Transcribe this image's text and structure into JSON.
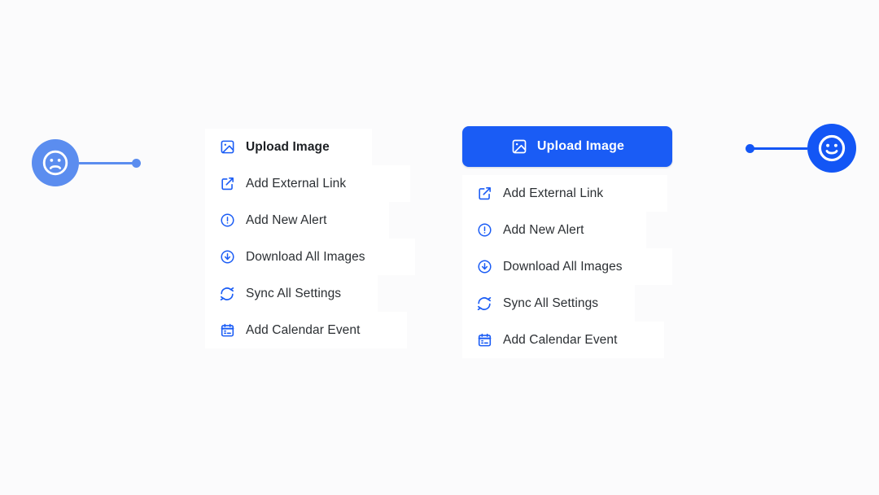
{
  "page": {
    "background_color": "#fbfbfc",
    "accent_color": "#1a5cf5",
    "muted_accent_color": "#5b8def"
  },
  "markers": {
    "before": {
      "name": "sad-face-marker",
      "face_icon": "sad-face-icon",
      "color": "#5b8def"
    },
    "after": {
      "name": "happy-face-marker",
      "face_icon": "happy-face-icon",
      "color": "#1356f5"
    }
  },
  "panel_before": {
    "items": [
      {
        "label": "Upload Image",
        "icon": "image-icon",
        "emphasis": "bold"
      },
      {
        "label": "Add External Link",
        "icon": "external-link-icon",
        "emphasis": "normal"
      },
      {
        "label": "Add New Alert",
        "icon": "alert-circle-icon",
        "emphasis": "normal"
      },
      {
        "label": "Download All Images",
        "icon": "download-circle-icon",
        "emphasis": "normal"
      },
      {
        "label": "Sync All Settings",
        "icon": "sync-icon",
        "emphasis": "normal"
      },
      {
        "label": "Add Calendar Event",
        "icon": "calendar-icon",
        "emphasis": "normal"
      }
    ]
  },
  "panel_after": {
    "primary_button": {
      "label": "Upload Image",
      "icon": "image-icon",
      "background_color": "#1a5cf5",
      "text_color": "#ffffff"
    },
    "items": [
      {
        "label": "Add External Link",
        "icon": "external-link-icon",
        "emphasis": "normal"
      },
      {
        "label": "Add New Alert",
        "icon": "alert-circle-icon",
        "emphasis": "normal"
      },
      {
        "label": "Download All Images",
        "icon": "download-circle-icon",
        "emphasis": "normal"
      },
      {
        "label": "Sync All Settings",
        "icon": "sync-icon",
        "emphasis": "normal"
      },
      {
        "label": "Add Calendar Event",
        "icon": "calendar-icon",
        "emphasis": "normal"
      }
    ]
  }
}
